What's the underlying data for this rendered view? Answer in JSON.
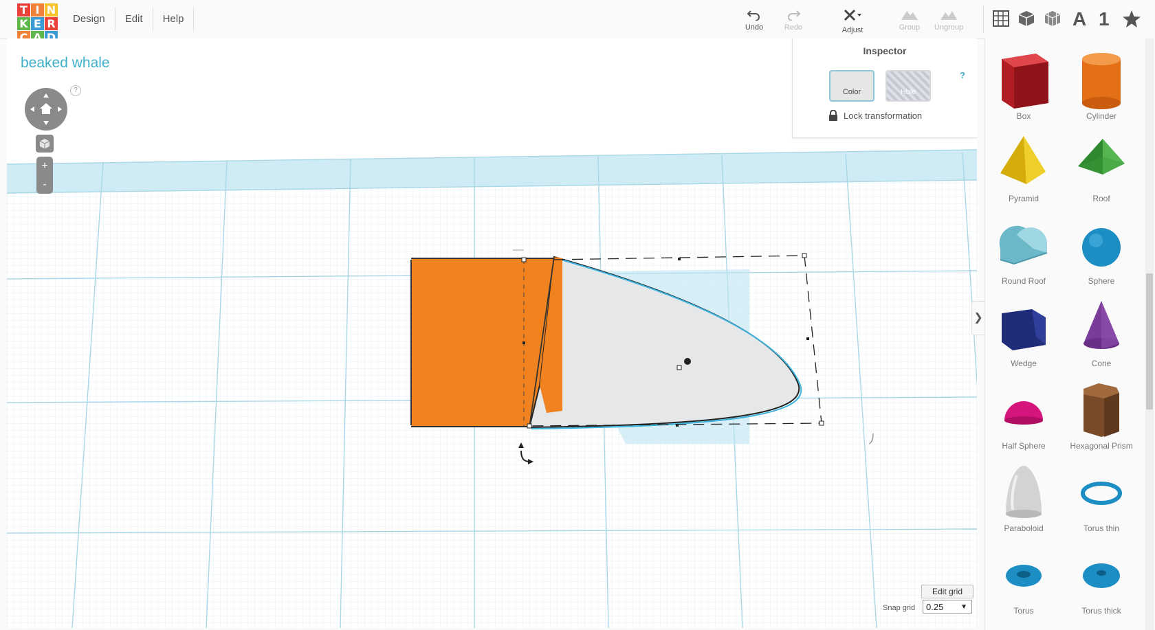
{
  "app": {
    "logo_letters": [
      "T",
      "I",
      "N",
      "K",
      "E",
      "R",
      "C",
      "A",
      "D"
    ],
    "logo_colors": [
      "#e8423b",
      "#f0813a",
      "#f5c22b",
      "#5fb64b",
      "#3a9bd5",
      "#e8423b",
      "#f0813a",
      "#5fb64b",
      "#3a9bd5"
    ]
  },
  "menu": {
    "design": "Design",
    "edit": "Edit",
    "help": "Help"
  },
  "toolbar": {
    "undo": "Undo",
    "redo": "Redo",
    "adjust": "Adjust",
    "group": "Group",
    "ungroup": "Ungroup",
    "text_tool": "A",
    "number_tool": "1"
  },
  "workspace": {
    "title": "beaked whale",
    "nav_help": "?",
    "zoom_in": "+",
    "zoom_out": "-"
  },
  "inspector": {
    "title": "Inspector",
    "color_label": "Color",
    "hole_label": "Hole",
    "help": "?",
    "lock_label": "Lock transformation"
  },
  "snap": {
    "edit_grid": "Edit grid",
    "label": "Snap grid",
    "value": "0.25"
  },
  "shapes": [
    {
      "name": "Box",
      "color": "#c9252c"
    },
    {
      "name": "Cylinder",
      "color": "#e8731e"
    },
    {
      "name": "Pyramid",
      "color": "#e8c31b"
    },
    {
      "name": "Roof",
      "color": "#3b9b3b"
    },
    {
      "name": "Round Roof",
      "color": "#7ccad8"
    },
    {
      "name": "Sphere",
      "color": "#1d8ec4"
    },
    {
      "name": "Wedge",
      "color": "#2a3a8c"
    },
    {
      "name": "Cone",
      "color": "#7a3b9a"
    },
    {
      "name": "Half Sphere",
      "color": "#d6157c"
    },
    {
      "name": "Hexagonal Prism",
      "color": "#8a5a35"
    },
    {
      "name": "Paraboloid",
      "color": "#d8d8d8"
    },
    {
      "name": "Torus thin",
      "color": "#1d8ec4"
    },
    {
      "name": "Torus",
      "color": "#1d8ec4"
    },
    {
      "name": "Torus thick",
      "color": "#1d8ec4"
    }
  ],
  "colors": {
    "accent": "#3fb0c8",
    "orange_object": "#f0821f",
    "grey_object": "#e5e6e8",
    "grid_line": "#bfe3ee"
  }
}
